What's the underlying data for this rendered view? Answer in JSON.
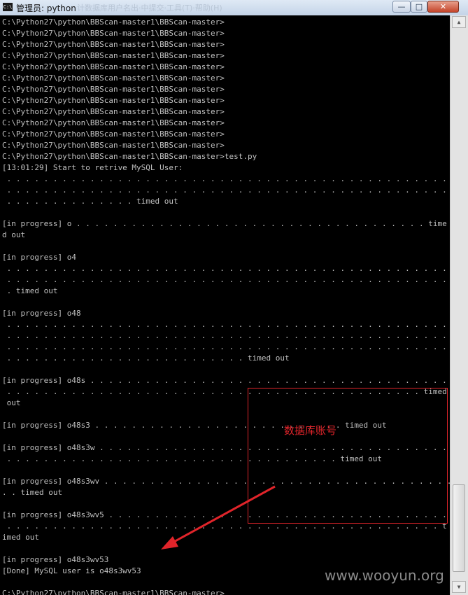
{
  "window": {
    "icon_label": "C:\\",
    "title": "管理员: python",
    "ghost_title": "计数据库用户名出·中提交·工具(T)·帮助(H)",
    "controls": {
      "minimize": "—",
      "maximize": "□",
      "close": "✕"
    }
  },
  "console_lines": [
    "C:\\Python27\\python\\BBScan-master1\\BBScan-master>",
    "C:\\Python27\\python\\BBScan-master1\\BBScan-master>",
    "C:\\Python27\\python\\BBScan-master1\\BBScan-master>",
    "C:\\Python27\\python\\BBScan-master1\\BBScan-master>",
    "C:\\Python27\\python\\BBScan-master1\\BBScan-master>",
    "C:\\Python27\\python\\BBScan-master1\\BBScan-master>",
    "C:\\Python27\\python\\BBScan-master1\\BBScan-master>",
    "C:\\Python27\\python\\BBScan-master1\\BBScan-master>",
    "C:\\Python27\\python\\BBScan-master1\\BBScan-master>",
    "C:\\Python27\\python\\BBScan-master1\\BBScan-master>",
    "C:\\Python27\\python\\BBScan-master1\\BBScan-master>",
    "C:\\Python27\\python\\BBScan-master1\\BBScan-master>",
    "C:\\Python27\\python\\BBScan-master1\\BBScan-master>test.py",
    "[13:01:29] Start to retrive MySQL User:",
    " . . . . . . . . . . . . . . . . . . . . . . . . . . . . . . . . . . . . . . . . . . . . . . . . .",
    " . . . . . . . . . . . . . . . . . . . . . . . . . . . . . . . . . . . . . . . . . . . . . . . . .",
    " . . . . . . . . . . . . . . timed out",
    "",
    "[in progress] o . . . . . . . . . . . . . . . . . . . . . . . . . . . . . . . . . . . . . . time",
    "d out",
    "",
    "[in progress] o4",
    " . . . . . . . . . . . . . . . . . . . . . . . . . . . . . . . . . . . . . . . . . . . . . . . . .",
    " . . . . . . . . . . . . . . . . . . . . . . . . . . . . . . . . . . . . . . . . . . . . . . . . .",
    " . timed out",
    "",
    "[in progress] o48",
    " . . . . . . . . . . . . . . . . . . . . . . . . . . . . . . . . . . . . . . . . . . . . . . . . .",
    " . . . . . . . . . . . . . . . . . . . . . . . . . . . . . . . . . . . . . . . . . . . . . . . . .",
    " . . . . . . . . . . . . . . . . . . . . . . . . . . . . . . . . . . . . . . . . . . . . . . . . .",
    " . . . . . . . . . . . . . . . . . . . . . . . . . . timed out",
    "",
    "[in progress] o48s . . . . . . . . . . . . . . . . . . . . . . . . . . . . . . . . . . . . . . . .",
    " . . . . . . . . . . . . . . . . . . . . . . . . . . . . . . . . . . . . . . . . . . . . . timed",
    " out",
    "",
    "[in progress] o48s3 . . . . . . . . . . . . . . . . . . . . . . . . . . . timed out",
    "",
    "[in progress] o48s3w . . . . . . . . . . . . . . . . . . . . . . . . . . . . . . . . . . . . . . .",
    " . . . . . . . . . . . . . . . . . . . . . . . . . . . . . . . . . . . . timed out",
    "",
    "[in progress] o48s3wv . . . . . . . . . . . . . . . . . . . . . . . . . . . . . . . . . . . . . .",
    ". . timed out",
    "",
    "[in progress] o48s3wv5 . . . . . . . . . . . . . . . . . . . . . . . . . . . . . . . . . . . . . .",
    " . . . . . . . . . . . . . . . . . . . . . . . . . . . . . . . . . . . . . . . . . . . . . . . t",
    "imed out",
    "",
    "[in progress] o48s3wv53",
    "[Done] MySQL user is o48s3wv53",
    "",
    "C:\\Python27\\python\\BBScan-master1\\BBScan-master>"
  ],
  "annotation": {
    "label": "数据库账号",
    "color": "#e0242a"
  },
  "watermark": "www.wooyun.org",
  "colors": {
    "console_bg": "#000000",
    "console_text": "#c0c0c0",
    "annotation": "#e0242a"
  }
}
